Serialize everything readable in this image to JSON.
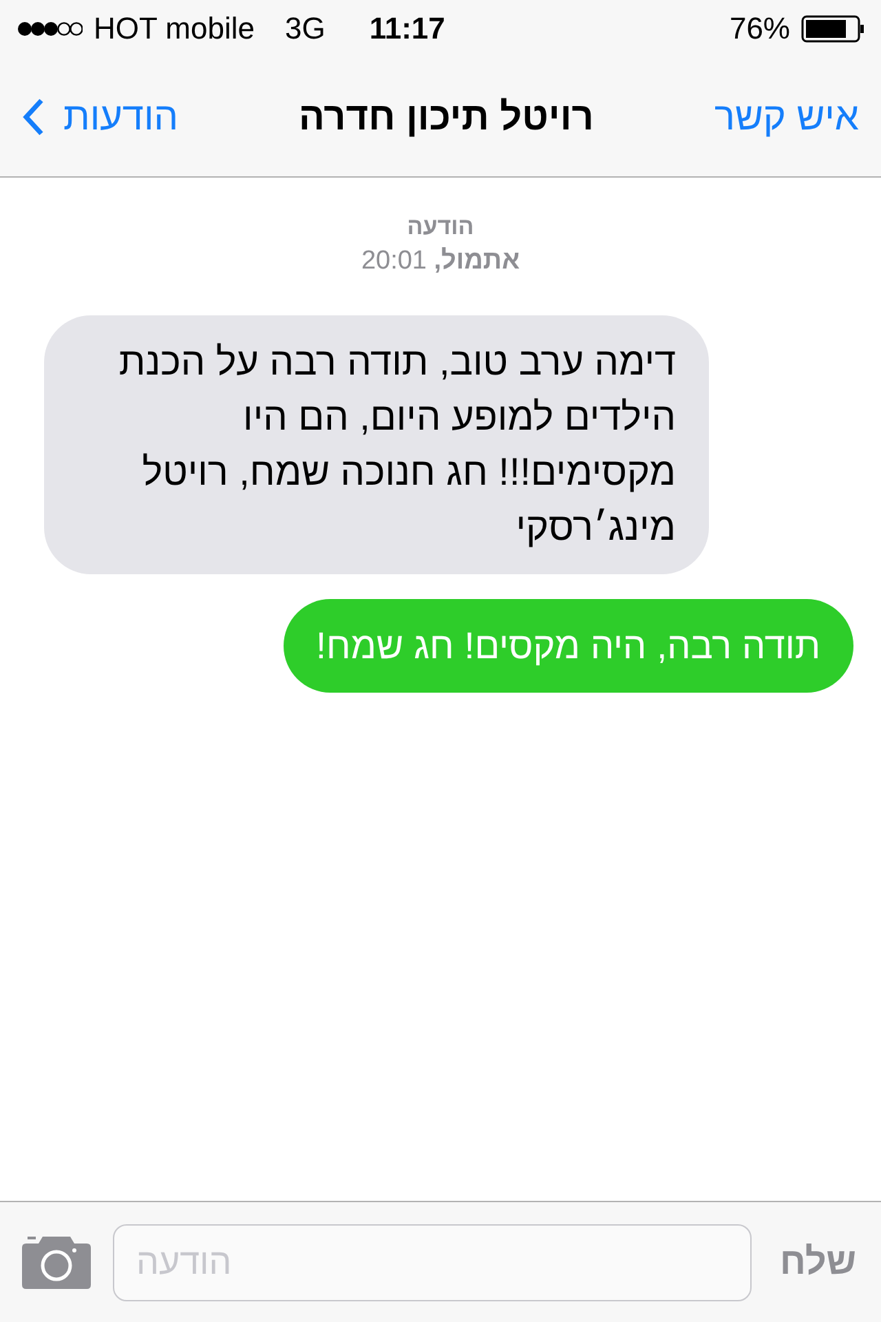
{
  "status_bar": {
    "carrier": "HOT mobile",
    "network": "3G",
    "time": "11:17",
    "battery": "76%"
  },
  "nav": {
    "back": "הודעות",
    "title": "רויטל תיכון חדרה",
    "action": "איש קשר"
  },
  "header": {
    "label": "הודעה",
    "timestamp": "**אתמול,** 20:01"
  },
  "messages": [
    {
      "kind": "received",
      "text": "דימה ערב טוב, תודה רבה על הכנת הילדים למופע היום, הם היו מקסימים!!! חג חנוכה שמח, רויטל מינג׳רסקי"
    },
    {
      "kind": "sent",
      "text": "תודה רבה, היה מקסים! חג שמח!"
    }
  ],
  "composer": {
    "placeholder": "הודעה",
    "send": "שלח",
    "disabled": true
  }
}
